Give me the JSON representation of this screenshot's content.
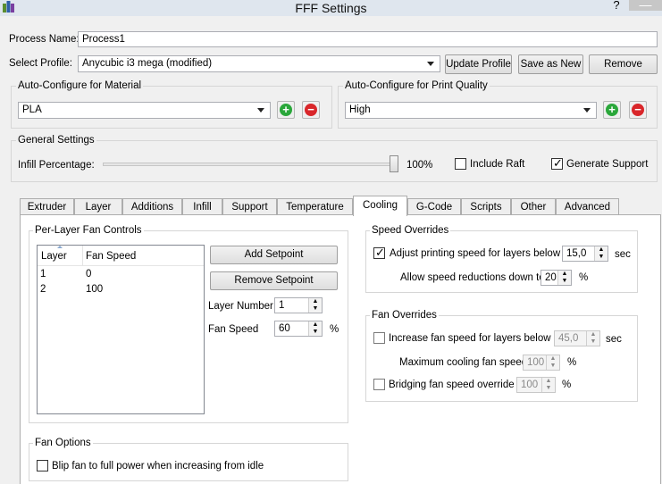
{
  "window": {
    "title": "FFF Settings",
    "help_glyph": "?",
    "close_glyph": "—"
  },
  "process": {
    "label": "Process Name:",
    "value": "Process1"
  },
  "profile": {
    "label": "Select Profile:",
    "selected": "Anycubic i3 mega (modified)",
    "update_label": "Update Profile",
    "save_as_new_label": "Save as New",
    "remove_label": "Remove"
  },
  "material": {
    "title": "Auto-Configure for Material",
    "selected": "PLA"
  },
  "quality": {
    "title": "Auto-Configure for Print Quality",
    "selected": "High"
  },
  "general": {
    "title": "General Settings",
    "infill_label": "Infill Percentage:",
    "infill_value_text": "100%",
    "infill_fraction": 1.0,
    "include_raft_label": "Include Raft",
    "include_raft_checked": false,
    "generate_support_label": "Generate Support",
    "generate_support_checked": true
  },
  "tabs": [
    "Extruder",
    "Layer",
    "Additions",
    "Infill",
    "Support",
    "Temperature",
    "Cooling",
    "G-Code",
    "Scripts",
    "Other",
    "Advanced"
  ],
  "active_tab": "Cooling",
  "cooling": {
    "per_layer": {
      "title": "Per-Layer Fan Controls",
      "columns": [
        "Layer",
        "Fan Speed"
      ],
      "rows": [
        [
          "1",
          "0"
        ],
        [
          "2",
          "100"
        ]
      ],
      "add_setpoint_label": "Add Setpoint",
      "remove_setpoint_label": "Remove Setpoint",
      "layer_number_label": "Layer Number",
      "layer_number_value": "1",
      "fan_speed_label": "Fan Speed",
      "fan_speed_value": "60",
      "fan_speed_unit": "%"
    },
    "fan_options": {
      "title": "Fan Options",
      "blip_label": "Blip fan to full power when increasing from idle",
      "blip_checked": false
    },
    "speed_overrides": {
      "title": "Speed Overrides",
      "adjust_label": "Adjust printing speed for layers below",
      "adjust_checked": true,
      "adjust_value": "15,0",
      "adjust_unit": "sec",
      "allow_label": "Allow speed reductions down to",
      "allow_value": "20",
      "allow_unit": "%"
    },
    "fan_overrides": {
      "title": "Fan Overrides",
      "increase_label": "Increase fan speed for layers below",
      "increase_checked": false,
      "increase_value": "45,0",
      "increase_unit": "sec",
      "max_cooling_label": "Maximum cooling fan speed",
      "max_cooling_value": "100",
      "max_cooling_unit": "%",
      "bridging_label": "Bridging fan speed override",
      "bridging_checked": false,
      "bridging_value": "100",
      "bridging_unit": "%"
    }
  },
  "colors": {
    "add_green": "#2aa73a",
    "remove_red": "#d9262a",
    "title_bar": "#dfe6ee"
  }
}
